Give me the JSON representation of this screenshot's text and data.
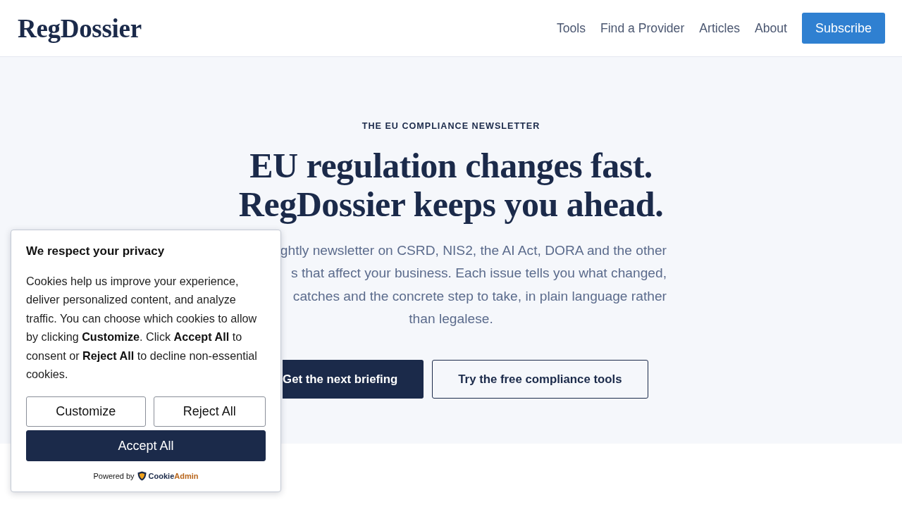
{
  "header": {
    "logo": "RegDossier",
    "nav": [
      {
        "label": "Tools"
      },
      {
        "label": "Find a Provider"
      },
      {
        "label": "Articles"
      },
      {
        "label": "About"
      }
    ],
    "cta": "Subscribe"
  },
  "hero": {
    "eyebrow": "THE EU COMPLIANCE NEWSLETTER",
    "headline": [
      "EU regulation changes fast.",
      "RegDossier keeps you ahead."
    ],
    "intro_lines": [
      {
        "text": "ghtly newsletter on CSRD, NIS2, the AI Act, DORA and the other",
        "covered": true
      },
      {
        "text": "s that affect your business. Each issue tells you what changed,",
        "covered": true
      },
      {
        "text": "catches and the concrete step to take, in plain language rather",
        "covered": true
      },
      {
        "text": "than legalese.",
        "covered": false
      }
    ],
    "buttons": [
      {
        "label": "Get the next briefing",
        "kind": "primary",
        "covered": true
      },
      {
        "label": "Try the free compliance tools",
        "kind": "secondary",
        "covered": false
      }
    ]
  },
  "cookie_banner": {
    "title": "We respect your privacy",
    "body": "Cookies help us improve your experience, deliver personalized content, and analyze traffic. You can choose which cookies to allow by clicking **Customize**. Click **Accept All** to consent or **Reject All** to decline non-essential cookies.",
    "buttons": [
      {
        "label": "Customize",
        "kind": "outline"
      },
      {
        "label": "Reject All",
        "kind": "outline"
      },
      {
        "label": "Accept All",
        "kind": "solid"
      }
    ],
    "powered_by": "Powered by",
    "brand": [
      "Cookie",
      "Admin"
    ]
  }
}
